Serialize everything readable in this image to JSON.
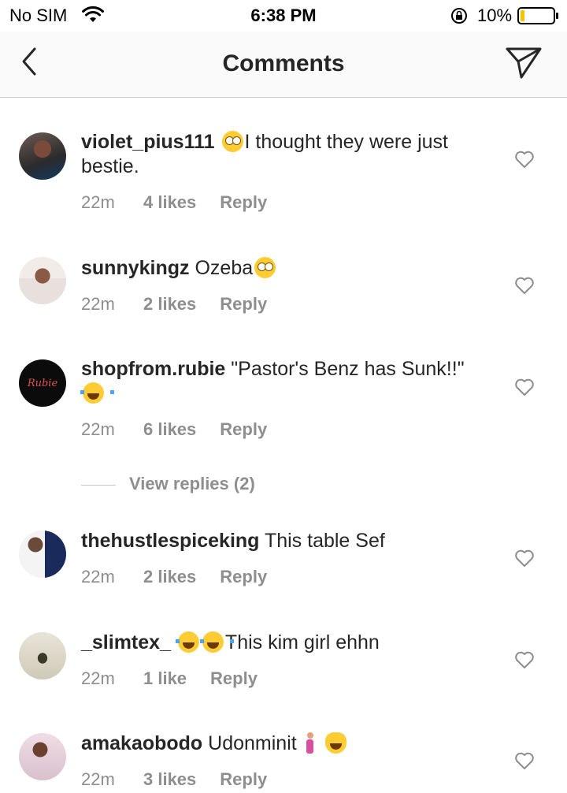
{
  "status_bar": {
    "carrier": "No SIM",
    "time": "6:38 PM",
    "battery": "10%",
    "icons": [
      "wifi-icon",
      "orientation-lock-icon",
      "battery-icon"
    ]
  },
  "nav": {
    "title": "Comments",
    "back_icon": "chevron-left-icon",
    "send_icon": "paper-plane-icon"
  },
  "comments": [
    {
      "username": "violet_pius111",
      "text_before": "",
      "emoji_mid": "face-with-rolling-eyes",
      "text_after": "I thought they were just bestie.",
      "time": "22m",
      "likes": "4 likes",
      "reply": "Reply"
    },
    {
      "username": "sunnykingz",
      "text_before": "Ozeba",
      "emoji_end": "face-with-rolling-eyes",
      "time": "22m",
      "likes": "2 likes",
      "reply": "Reply"
    },
    {
      "username": "shopfrom.rubie",
      "text_before": "\"Pastor's Benz has Sunk!!\"",
      "emoji_end": "face-with-tears-of-joy",
      "time": "22m",
      "likes": "6 likes",
      "reply": "Reply",
      "avatar_text": "Rubie"
    },
    {
      "username": "thehustlespiceking",
      "text_before": "This table Sef",
      "time": "22m",
      "likes": "2 likes",
      "reply": "Reply"
    },
    {
      "username": "_slimtex_",
      "emoji_start": "face-with-tears-of-joy x2",
      "text_after": "This kim girl ehhn",
      "time": "22m",
      "likes": "1 like",
      "reply": "Reply"
    },
    {
      "username": "amakaobodo",
      "text_before": "Udonminit",
      "emoji_end": "woman-walking, cat-with-tears-of-joy",
      "time": "22m",
      "likes": "3 likes",
      "reply": "Reply"
    }
  ],
  "view_replies": "View replies (2)",
  "colors": {
    "text": "#262626",
    "meta": "#8e8e8e",
    "divider": "#cfcfcf"
  }
}
